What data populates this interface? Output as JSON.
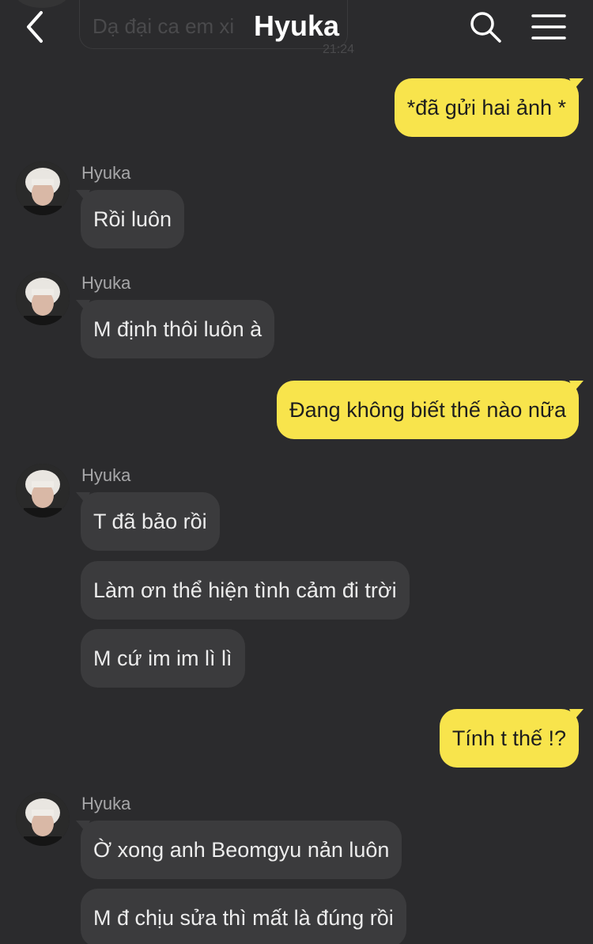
{
  "header": {
    "title": "Hyuka",
    "back_icon": "chevron-left-icon",
    "search_icon": "search-icon",
    "menu_icon": "hamburger-menu-icon"
  },
  "ghost": {
    "text": "Dạ đại ca em xi",
    "time": "21:24"
  },
  "colors": {
    "background": "#2b2b2d",
    "outgoing_bubble": "#f8e44c",
    "incoming_bubble": "#3b3b3d"
  },
  "messages": [
    {
      "direction": "out",
      "text": "*đã gửi hai ảnh *"
    },
    {
      "direction": "in",
      "sender": "Hyuka",
      "text": "Rồi luôn"
    },
    {
      "direction": "in",
      "sender": "Hyuka",
      "text": "M định thôi luôn à"
    },
    {
      "direction": "out",
      "text": "Đang không biết thế nào nữa"
    },
    {
      "direction": "in",
      "sender": "Hyuka",
      "text": "T đã bảo rồi"
    },
    {
      "direction": "in",
      "text": "Làm ơn thể hiện tình cảm đi trời"
    },
    {
      "direction": "in",
      "text": "M cứ im im lì lì"
    },
    {
      "direction": "out",
      "text": "Tính t thế !?"
    },
    {
      "direction": "in",
      "sender": "Hyuka",
      "text": "Ờ xong anh Beomgyu nản luôn"
    },
    {
      "direction": "in",
      "text": "M đ chịu sửa thì mất là đúng rồi"
    }
  ]
}
